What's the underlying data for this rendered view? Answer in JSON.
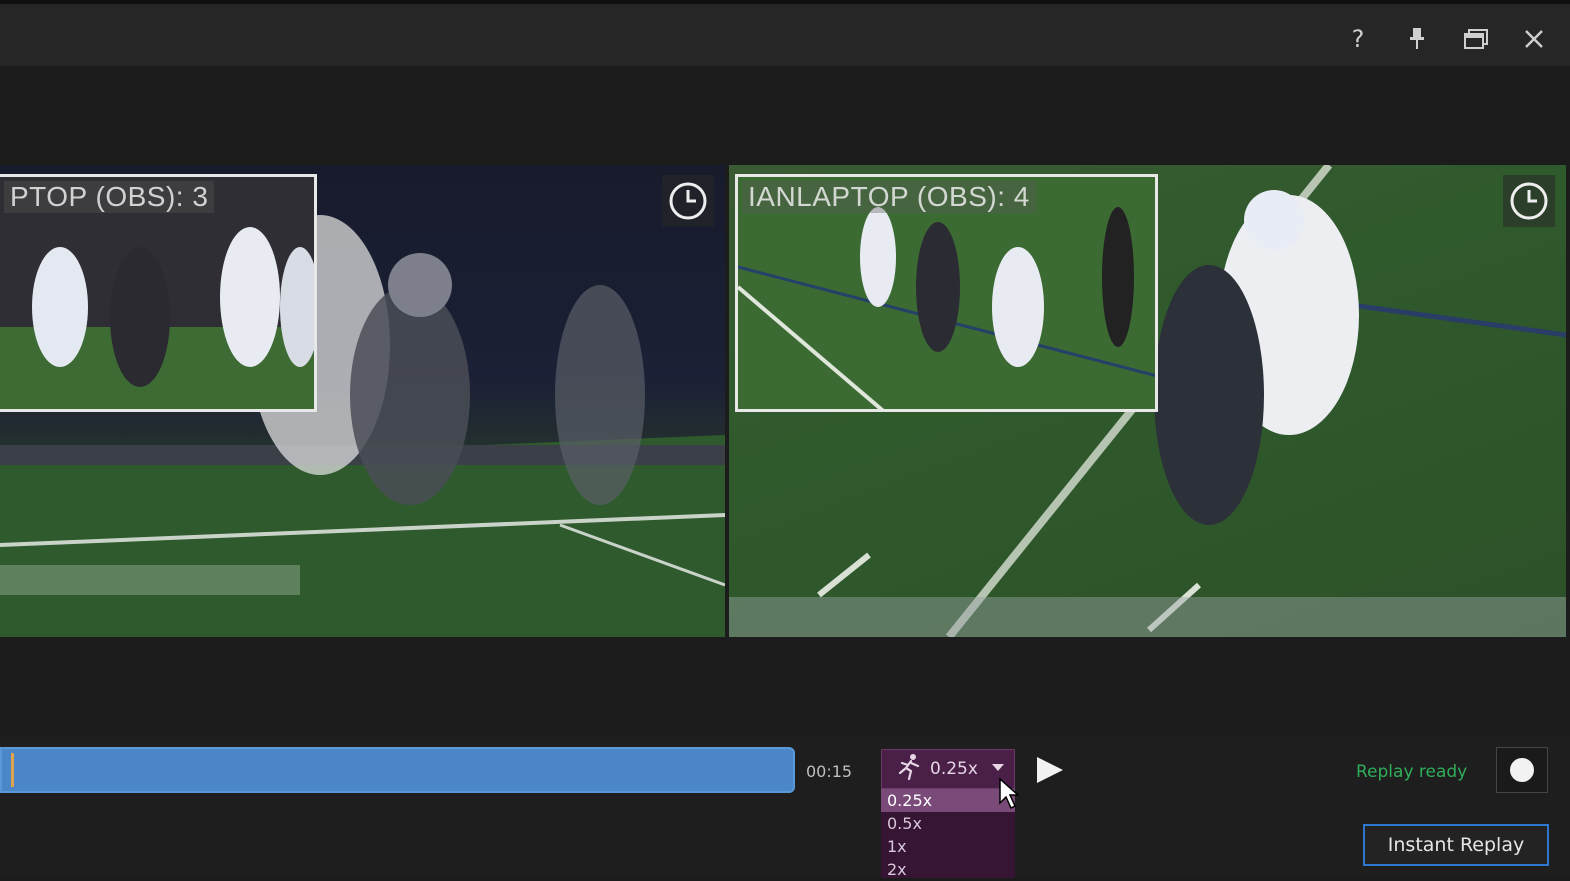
{
  "window": {
    "buttons": [
      {
        "name": "help-icon",
        "glyph": "?"
      },
      {
        "name": "pin-icon",
        "glyph": "pin"
      },
      {
        "name": "restore-window-icon",
        "glyph": "restore"
      },
      {
        "name": "close-icon",
        "glyph": "×"
      }
    ]
  },
  "panels": {
    "left": {
      "pip_label": "PTOP (OBS): 3",
      "icon": "clock-icon"
    },
    "right": {
      "pip_label": "IANLAPTOP (OBS): 4",
      "icon": "clock-icon"
    }
  },
  "controls": {
    "time": "00:15",
    "timeline_progress": 1.0,
    "speed": {
      "icon": "running-person-icon",
      "value": "0.25x",
      "options": [
        "0.25x",
        "0.5x",
        "1x",
        "2x"
      ],
      "selected_index": 0
    },
    "play_icon": "play-icon",
    "status": "Replay ready",
    "status_color": "#2fae5a",
    "record_icon": "record-icon",
    "instant_replay_label": "Instant Replay",
    "accent_color": "#2c78d0"
  }
}
